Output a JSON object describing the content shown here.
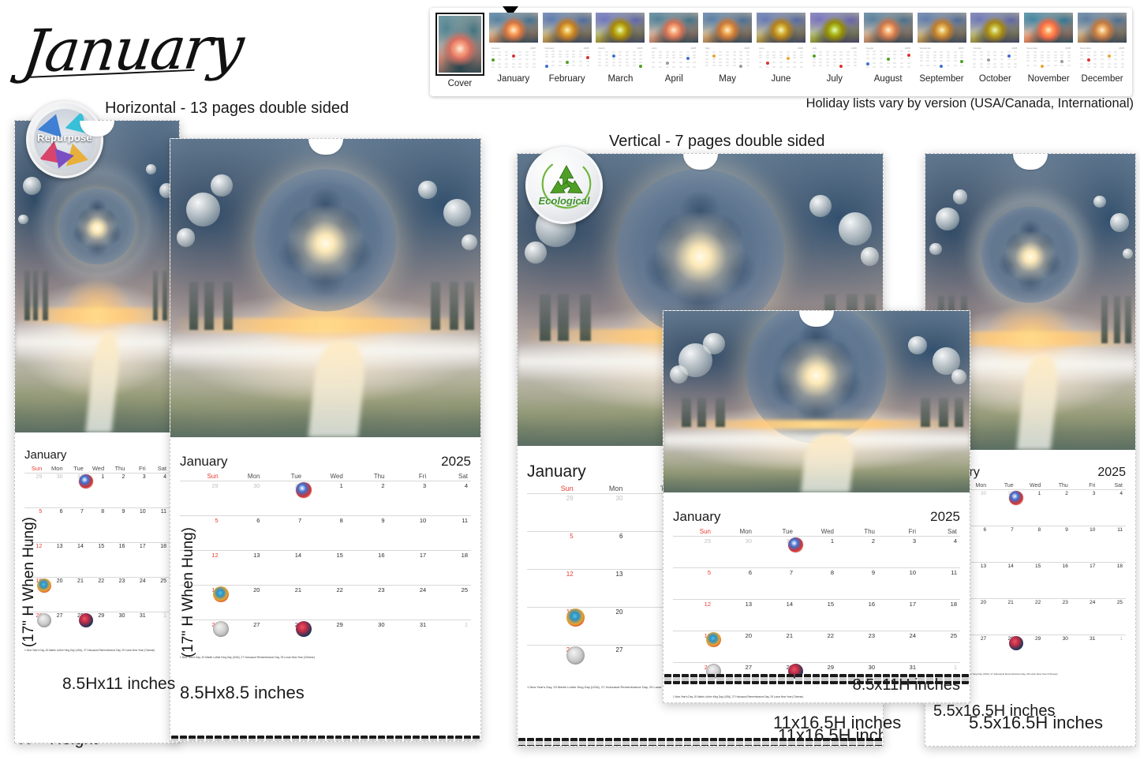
{
  "page": {
    "title": "January",
    "height_legend": "H = Height",
    "holiday_note": "Holiday lists vary by version (USA/Canada, International)"
  },
  "sections": {
    "horizontal_heading": "Horizontal - 13 pages double sided",
    "vertical_heading": "Vertical - 7 pages double sided"
  },
  "badges": {
    "repurpose": "Repurpose",
    "ecological": "Ecological"
  },
  "thumbnails": {
    "selected": "Cover",
    "items": [
      {
        "label": "Cover"
      },
      {
        "label": "January"
      },
      {
        "label": "February"
      },
      {
        "label": "March"
      },
      {
        "label": "April"
      },
      {
        "label": "May"
      },
      {
        "label": "June"
      },
      {
        "label": "July"
      },
      {
        "label": "August"
      },
      {
        "label": "September"
      },
      {
        "label": "October"
      },
      {
        "label": "November"
      },
      {
        "label": "December"
      }
    ]
  },
  "calendar": {
    "month": "January",
    "year": "2025",
    "weekdays": [
      "Sun",
      "Mon",
      "Tue",
      "Wed",
      "Thu",
      "Fri",
      "Sat"
    ],
    "weeks": [
      [
        "29",
        "30",
        "31",
        "1",
        "2",
        "3",
        "4"
      ],
      [
        "5",
        "6",
        "7",
        "8",
        "9",
        "10",
        "11"
      ],
      [
        "12",
        "13",
        "14",
        "15",
        "16",
        "17",
        "18"
      ],
      [
        "19",
        "20",
        "21",
        "22",
        "23",
        "24",
        "25"
      ],
      [
        "26",
        "27",
        "28",
        "29",
        "30",
        "31",
        "1"
      ]
    ],
    "outside_month": [
      [
        true,
        true,
        true,
        false,
        false,
        false,
        false
      ],
      [
        false,
        false,
        false,
        false,
        false,
        false,
        false
      ],
      [
        false,
        false,
        false,
        false,
        false,
        false,
        false
      ],
      [
        false,
        false,
        false,
        false,
        false,
        false,
        false
      ],
      [
        false,
        false,
        false,
        false,
        false,
        false,
        true
      ]
    ],
    "holiday_icons": [
      {
        "week": 0,
        "day": 3,
        "kind": "hi-ny",
        "name": "new-years-day-icon"
      },
      {
        "week": 3,
        "day": 1,
        "kind": "hi-mlk",
        "name": "martin-luther-king-day-icon"
      },
      {
        "week": 4,
        "day": 1,
        "kind": "hi-holo",
        "name": "holocaust-remembrance-day-icon"
      },
      {
        "week": 4,
        "day": 3,
        "kind": "hi-lny",
        "name": "lunar-new-year-icon"
      }
    ],
    "footnote": "1 New Year's Day, 20 Martin Luther King Day (USA), 27 Holocaust Remembrance Day, 29 Lunar New Year (Chinese)"
  },
  "products": [
    {
      "id": "prod-a",
      "size_caption": "8.5Hx11 inches",
      "hang_label": "(17\" H When Hung)"
    },
    {
      "id": "prod-b",
      "size_caption": "8.5Hx8.5 inches",
      "hang_label": "(17\" H When Hung)"
    },
    {
      "id": "prod-c",
      "size_caption": "11x16.5H inches",
      "hang_label": ""
    },
    {
      "id": "prod-d",
      "size_caption": "8.5x11H inches",
      "hang_label": ""
    },
    {
      "id": "prod-e",
      "size_caption": "5.5x16.5H inches",
      "hang_label": ""
    }
  ],
  "colors": {
    "sunday_red": "#e8392e",
    "text_dark": "#1b1b1b",
    "muted_gray": "#c0c0c0",
    "eco_green": "#3f8f2c"
  }
}
